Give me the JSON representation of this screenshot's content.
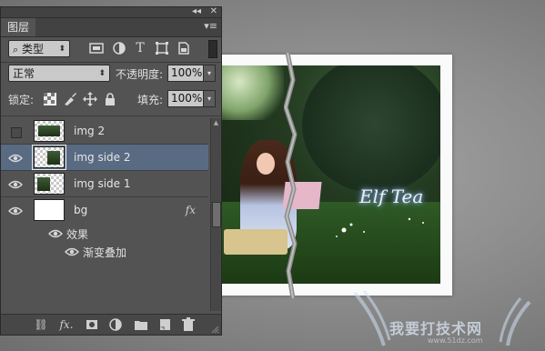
{
  "panel": {
    "collapse_glyph": "◂◂",
    "close_glyph": "✕",
    "tab_label": "图层",
    "menu_glyph": "▾≡",
    "filter": {
      "label": "类型",
      "search_glyph": "⌕",
      "arrow": "⬍"
    },
    "filter_icons": [
      "image-filter-icon",
      "adjustment-filter-icon",
      "type-filter-icon",
      "shape-filter-icon",
      "smart-object-filter-icon"
    ],
    "type_glyph": "T",
    "blend_mode": "正常",
    "opacity_label": "不透明度:",
    "opacity_value": "100%",
    "lock_label": "锁定:",
    "fill_label": "填充:",
    "fill_value": "100%",
    "dropdown_arrow": "▾",
    "layers": [
      {
        "name": "img 2",
        "visible": false,
        "selected": false
      },
      {
        "name": "img side 2",
        "visible": true,
        "selected": true
      },
      {
        "name": "img side 1",
        "visible": true,
        "selected": false
      },
      {
        "name": "bg",
        "visible": true,
        "selected": false,
        "fx": "fx"
      }
    ],
    "effects_label": "效果",
    "effect_item": "渐变叠加",
    "bottom_icons": [
      "link-layers-icon",
      "add-style-icon",
      "add-mask-icon",
      "adjustment-layer-icon",
      "new-group-icon",
      "new-layer-icon",
      "delete-layer-icon"
    ],
    "bottom_glyphs": {
      "link": "⛓",
      "fx": "fx."
    }
  },
  "canvas": {
    "signature": "Elf Tea",
    "watermark_text": "我要打技术网",
    "watermark_url": "www.51dz.com"
  }
}
